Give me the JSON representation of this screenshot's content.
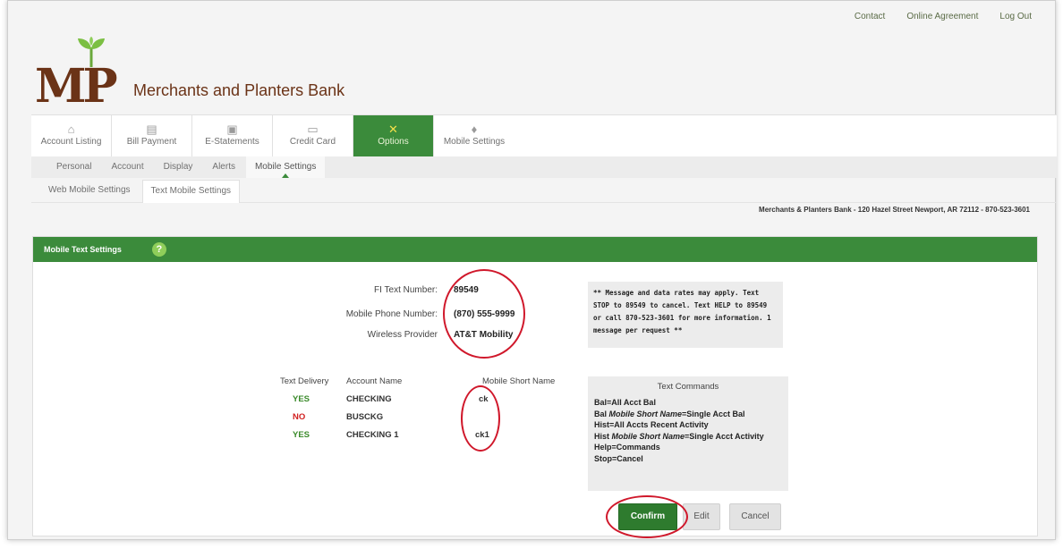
{
  "top_links": [
    "Contact",
    "Online Agreement",
    "Log Out"
  ],
  "bank": {
    "logo_letters": "MP",
    "name": "Merchants and Planters Bank"
  },
  "main_tabs": [
    {
      "label": "Account Listing",
      "icon": "home-icon"
    },
    {
      "label": "Bill Payment",
      "icon": "bill-icon"
    },
    {
      "label": "E-Statements",
      "icon": "briefcase-icon"
    },
    {
      "label": "Credit Card",
      "icon": "credit-card-icon"
    },
    {
      "label": "Options",
      "icon": "tools-icon",
      "active": true
    },
    {
      "label": "Mobile Settings",
      "icon": "lightbulb-icon"
    }
  ],
  "sub_tabs": [
    "Personal",
    "Account",
    "Display",
    "Alerts",
    "Mobile Settings"
  ],
  "third_tabs": [
    "Web Mobile Settings",
    "Text Mobile Settings"
  ],
  "address": "Merchants & Planters Bank - 120 Hazel Street Newport, AR 72112 - 870-523-3601",
  "panel": {
    "title": "Mobile Text Settings",
    "help": "?",
    "fi_text_label": "FI Text Number:",
    "fi_text_value": "89549",
    "phone_label": "Mobile Phone Number:",
    "phone_value": "(870) 555-9999",
    "provider_label": "Wireless Provider",
    "provider_value": "AT&T Mobility",
    "note": "** Message and data rates may apply. Text STOP to 89549 to cancel. Text HELP to 89549 or call 870-523-3601 for more information. 1 message per request **"
  },
  "accounts_table": {
    "headers": [
      "Text Delivery",
      "Account Name",
      "Mobile Short Name"
    ],
    "rows": [
      {
        "delivery": "YES",
        "name": "CHECKING",
        "short": "ck"
      },
      {
        "delivery": "NO",
        "name": "BUSCKG",
        "short": ""
      },
      {
        "delivery": "YES",
        "name": "CHECKING 1",
        "short": "ck1"
      }
    ]
  },
  "commands": {
    "title": "Text Commands",
    "lines": [
      {
        "pre": "Bal=All Acct Bal",
        "ital": "",
        "post": ""
      },
      {
        "pre": "Bal ",
        "ital": "Mobile Short Name",
        "post": "=Single Acct Bal"
      },
      {
        "pre": "Hist=All Accts Recent Activity",
        "ital": "",
        "post": ""
      },
      {
        "pre": "Hist ",
        "ital": "Mobile Short Name",
        "post": "=Single Acct Activity"
      },
      {
        "pre": "Help=Commands",
        "ital": "",
        "post": ""
      },
      {
        "pre": "Stop=Cancel",
        "ital": "",
        "post": ""
      }
    ]
  },
  "buttons": {
    "confirm": "Confirm",
    "edit": "Edit",
    "cancel": "Cancel"
  },
  "colors": {
    "accent": "#3b8b3b",
    "brand": "#6b3317",
    "highlight_circle": "#d0182b",
    "yes": "#3a8a2a",
    "no": "#d22020"
  }
}
